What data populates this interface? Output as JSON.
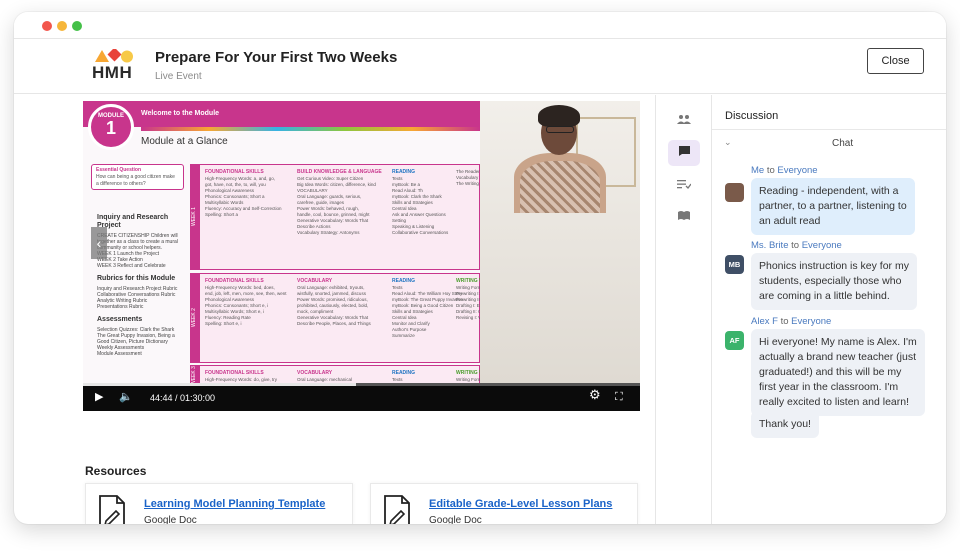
{
  "header": {
    "logo_text": "HMH",
    "title": "Prepare For Your First Two Weeks",
    "subtitle": "Live Event",
    "close_label": "Close"
  },
  "video": {
    "slide": {
      "module_label": "MODULE",
      "module_number": "1",
      "welcome": "Welcome to the Module",
      "heading": "Module at a Glance",
      "essential_question_title": "Essential Question",
      "essential_question": "How can being a good citizen make a difference to others?",
      "left_sections": [
        {
          "heading": "Inquiry and Research Project",
          "lines": [
            "CREATE CITIZENSHIP Children will",
            "together as a class to create a mural",
            "community or school helpers.",
            "WEEK 1 Launch the Project",
            "WEEK 2 Take Action",
            "WEEK 3 Reflect and Celebrate"
          ]
        },
        {
          "heading": "Rubrics for this Module",
          "lines": [
            "Inquiry and Research Project Rubric",
            "Collaborative Conversations Rubric",
            "Analytic Writing Rubric",
            "Presentations Rubric"
          ]
        },
        {
          "heading": "Assessments",
          "lines": [
            "Selection Quizzes: Clark the Shark",
            "The Great Puppy Invasion, Being a",
            "Good Citizen, Picture Dictionary",
            "Weekly Assessments",
            "Module Assessment"
          ]
        }
      ],
      "weeks": [
        {
          "tab": "WEEK 1",
          "foundational": "FOUNDATIONAL SKILLS",
          "foundational_lines": [
            "High-Frequency Words: a, and, go,",
            "got, have, not, the, to, will, you",
            "Phonological Awareness",
            "Phonics: Consonants; Short a",
            "Multisyllabic Words",
            "Fluency: Accuracy and Self-Correction",
            "Spelling: Short a"
          ],
          "build": "BUILD KNOWLEDGE & LANGUAGE",
          "build_lines": [
            "Get Curious Video: Super Citizen",
            "Big Idea Words: citizen, difference, kind",
            "VOCABULARY",
            "Oral Language: guards, serious,",
            "carefree, guide, images",
            "Power Words: behaved, rough,",
            "handle, cool, bounce, grinned, might",
            "Generative Vocabulary: Words That",
            "Describe Actions",
            "Vocabulary Strategy: Antonyms"
          ],
          "reading": "READING",
          "reading_lines": [
            "Texts",
            "myBook: Be a",
            "Read Aloud: Th",
            "myBook: Clark the Shark",
            "Skills and Strategies",
            "Central Idea",
            "Ask and Answer Questions",
            "Setting",
            "Speaking & Listening",
            "Collaborative Conversations"
          ],
          "writing_lines": [
            "The Reader",
            "Vocabulary",
            "The Writing Process"
          ]
        },
        {
          "tab": "WEEK 2",
          "foundational": "FOUNDATIONAL SKILLS",
          "foundational_lines": [
            "High-Frequency Words: bed, does,",
            "end, job, left, men, more, see, then, went",
            "Phonological Awareness",
            "Phonics: Consonants; Short e, i",
            "Multisyllabic Words; Short e, i",
            "Fluency: Reading Rate",
            "Spelling: Short e, i"
          ],
          "build": "VOCABULARY",
          "build_lines": [
            "Oral Language: exhibited, tryouts,",
            "wistfully, snorted, jammed, discuss",
            "Power Words: promised, ridiculous,",
            "prohibited, cautiously, elected, bold,",
            "mock, compliment",
            "Generative Vocabulary: Words That",
            "Describe People, Places, and Things"
          ],
          "reading": "READING",
          "reading_lines": [
            "Texts",
            "Read Aloud: The William Hoy Story",
            "myBook: The Great Puppy Invasion",
            "myBook: Being a Good Citizen",
            "Skills and Strategies",
            "Central Idea",
            "Monitor and Clarify",
            "Author's Purpose",
            "Summarize"
          ],
          "writing": "WRITING WORKSHOP",
          "writing_lines": [
            "Writing Form: Personal Narrative",
            "Prewriting I: Preparing to Write",
            "Prewriting II: Organizing the Story",
            "Drafting I: Elements of Narrative Te",
            "Drafting II: Completing the Draft",
            "Revising I: Word Choice"
          ]
        },
        {
          "tab": "WEEK 3",
          "foundational": "FOUNDATIONAL SKILLS",
          "foundational_lines": [
            "High-Frequency Words: do, give, try"
          ],
          "build": "VOCABULARY",
          "build_lines": [
            "Oral Language: mechanical"
          ],
          "reading": "READING",
          "reading_lines": [
            "Texts"
          ],
          "writing": "WRITING WORKSHOP",
          "writing_lines": [
            "Writing Form: Personal Narrative"
          ]
        }
      ]
    },
    "time": "44:44 / 01:30:00",
    "progress": 0.49
  },
  "resources": {
    "title": "Resources",
    "items": [
      {
        "label": "Learning Model Planning Template",
        "type": "Google Doc"
      },
      {
        "label": "Editable Grade-Level Lesson Plans",
        "type": "Google Doc"
      }
    ]
  },
  "discussion": {
    "title": "Discussion",
    "chat_label": "Chat",
    "messages": [
      {
        "from": "Me",
        "to_word": "to",
        "to": "Everyone",
        "avatar": "",
        "avatar_color": "#7a5a4a",
        "lines": [
          "Reading - independent, with a",
          "partner, to a partner, listening to",
          "an adult read"
        ],
        "mine": true
      },
      {
        "from": "Ms. Brite",
        "to_word": "to",
        "to": "Everyone",
        "avatar": "MB",
        "avatar_color": "#3f4f66",
        "lines": [
          "Phonics instruction is key for my",
          "students, especially those who",
          "are coming in a little behind."
        ],
        "mine": false
      },
      {
        "from": "Alex F",
        "to_word": "to",
        "to": "Everyone",
        "avatar": "AF",
        "avatar_color": "#3bb36b",
        "lines": [
          "Hi everyone! My name is Alex. I'm",
          "actually a brand new teacher (just",
          "graduated!) and this will be my",
          "first year in the classroom. I'm",
          "really excited to listen and learn!"
        ],
        "extra": "Thank you!",
        "mine": false
      }
    ]
  },
  "colors": {
    "accent": "#c8358c",
    "link": "#1a63c8",
    "chat_active": "#ede6f7"
  }
}
